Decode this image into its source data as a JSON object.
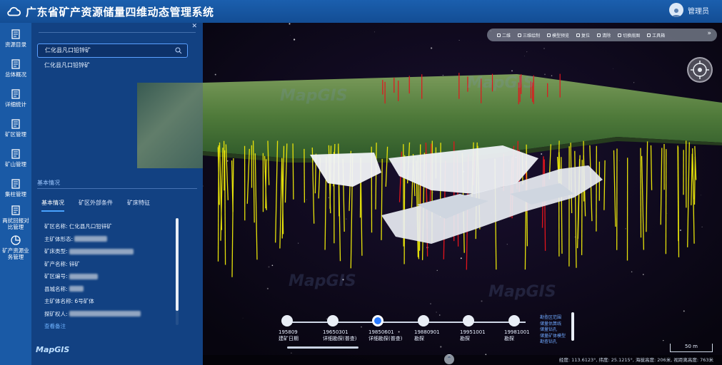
{
  "header": {
    "title": "广东省矿产资源储量四维动态管理系统",
    "user": "管理员"
  },
  "nav": {
    "items": [
      {
        "label": "资源目录"
      },
      {
        "label": "总体概况"
      },
      {
        "label": "详细统计"
      },
      {
        "label": "矿区管理"
      },
      {
        "label": "矿山管理"
      },
      {
        "label": "集柱管理"
      },
      {
        "label": "两扰回报对比管理"
      },
      {
        "label": "矿产资源业务管理"
      }
    ]
  },
  "panel": {
    "search_value": "仁化县凡口铅锌矿",
    "suggestion": "仁化县凡口铅锌矿",
    "section_title": "基本情况",
    "tabs": [
      {
        "label": "基本情况"
      },
      {
        "label": "矿区外部条件"
      },
      {
        "label": "矿床特征"
      }
    ],
    "info": {
      "mine_name_label": "矿区名称:",
      "mine_name": "仁化县凡口铅锌矿",
      "body_label": "主矿体形态:",
      "type_label": "矿床类型:",
      "mineral_label": "矿产名称:",
      "mineral": "锌矿",
      "code_label": "矿区编号:",
      "county_label": "县城名称:",
      "main_body_label": "主矿体名称:",
      "main_body": "6号矿体",
      "owner_label": "探矿权人:",
      "more_link": "查看备注"
    },
    "logo": "MapGIS"
  },
  "toolbar": {
    "items": [
      {
        "label": "二维"
      },
      {
        "label": "三维绘制"
      },
      {
        "label": "模型预览"
      },
      {
        "label": "复位"
      },
      {
        "label": "清除"
      },
      {
        "label": "切换底图"
      },
      {
        "label": "工具箱"
      }
    ]
  },
  "timeline": {
    "nodes": [
      {
        "date": "195809",
        "event": "建矿日期"
      },
      {
        "date": "19650301",
        "event": "详细勘探(普查)"
      },
      {
        "date": "19850601",
        "event": "详细勘探(普查)"
      },
      {
        "date": "19880901",
        "event": "勘探"
      },
      {
        "date": "19951001",
        "event": "勘探"
      },
      {
        "date": "19981001",
        "event": "勘探"
      }
    ],
    "active_index": 2,
    "legend": [
      "勘查区范围",
      "储量估算线",
      "储量钻孔",
      "储量矿体模型",
      "勘查钻孔"
    ]
  },
  "scale": "50 m",
  "status": "经度: 113.6123°, 纬度: 25.1215°, 海拔高度: 206米, 视距离高度: 763米",
  "watermark": "MapGIS",
  "colors": {
    "header": "#1b5fae",
    "nav": "#1a5aa6",
    "accent": "#2b7bff",
    "drill_yellow": "#e6e20a",
    "drill_red": "#e3141c"
  }
}
